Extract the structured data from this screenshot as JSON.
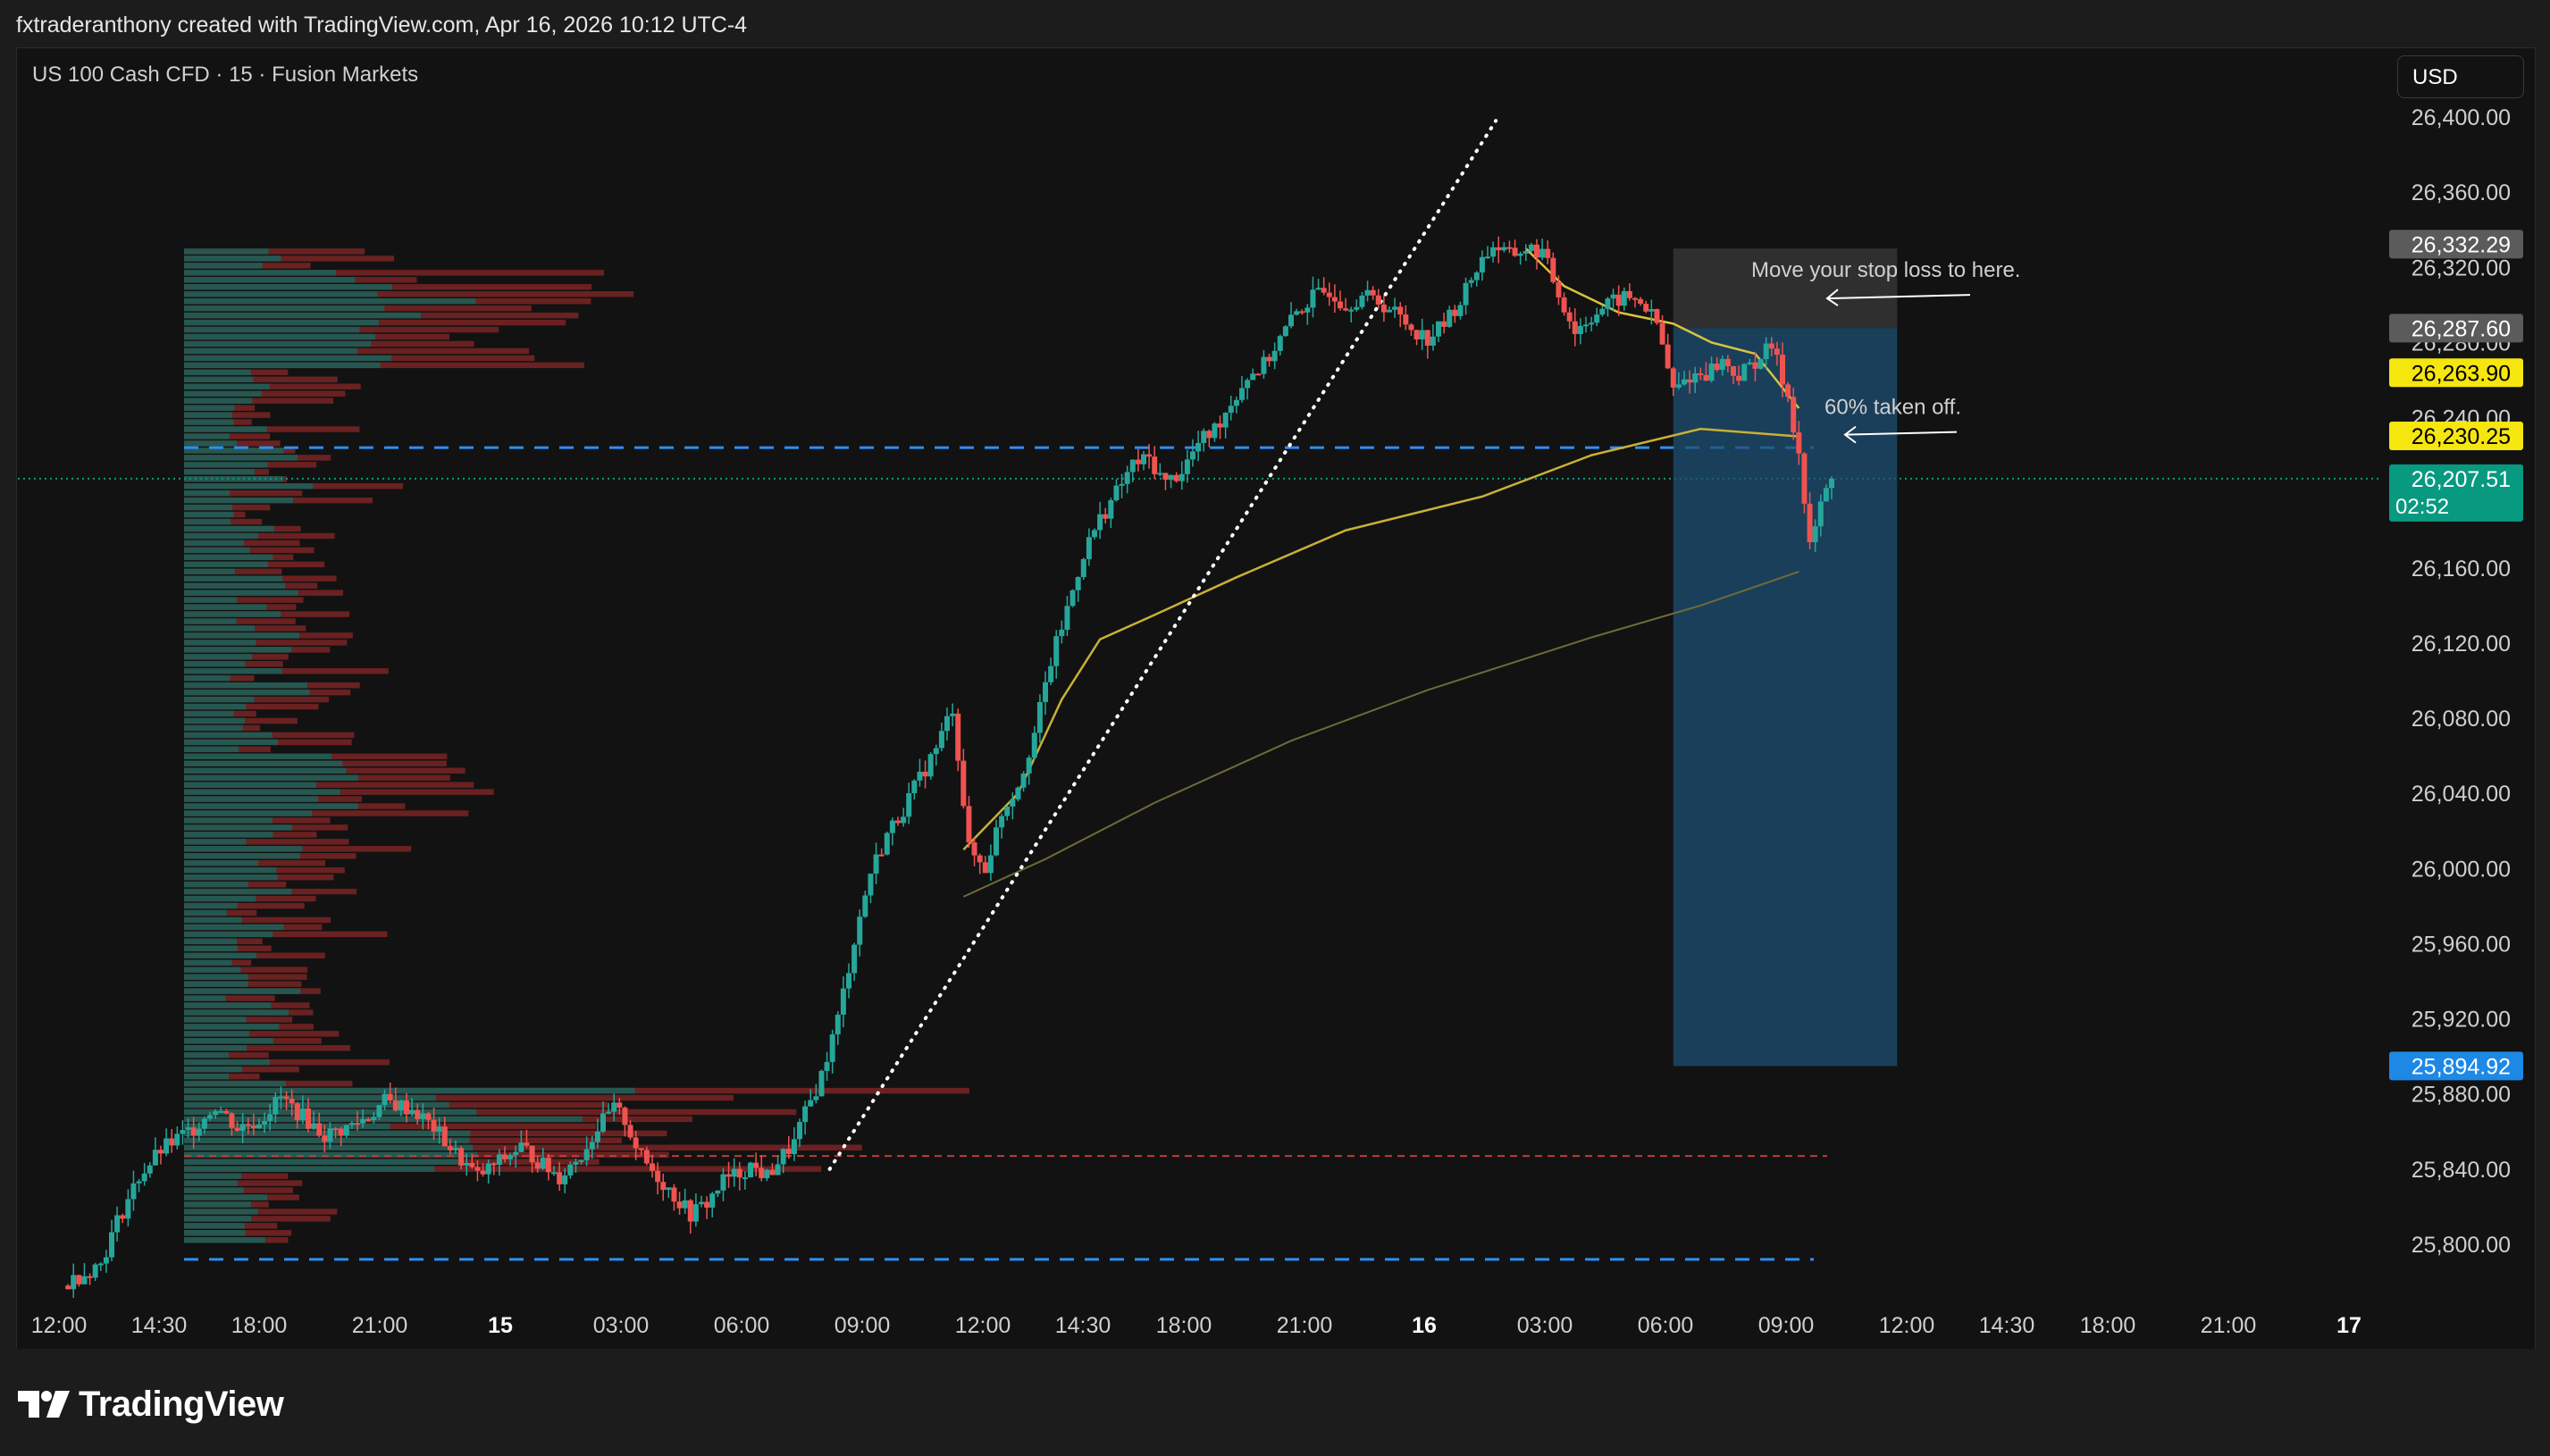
{
  "header": {
    "attribution": "fxtraderanthony created with TradingView.com, Apr 16, 2026 10:12 UTC-4"
  },
  "chart_header": {
    "symbol": "US 100 Cash CFD · 15 · Fusion Markets",
    "currency_button": "USD"
  },
  "branding": {
    "logo_text": "TradingView"
  },
  "colors": {
    "up": "#26a69a",
    "down": "#ef5350",
    "volume_up": "#1f5d55",
    "volume_down": "#7a2424",
    "ema_fast": "#c9b037",
    "ema_slow": "#6e6a3a",
    "position_blue": "#1e4f73",
    "stop_gray": "#555555",
    "dashed_level": "#2d8ff0",
    "last_price": "#089981"
  },
  "chart_data": {
    "type": "candlestick",
    "title": "US 100 Cash CFD · 15 · Fusion Markets",
    "xlabel": "",
    "ylabel": "",
    "ylim": [
      25770,
      26420
    ],
    "x_axis_labels": [
      "12:00",
      "14:30",
      "18:00",
      "21:00",
      "15",
      "03:00",
      "06:00",
      "09:00",
      "12:00",
      "14:30",
      "18:00",
      "21:00",
      "16",
      "03:00",
      "06:00",
      "09:00",
      "12:00",
      "14:30",
      "18:00",
      "21:00",
      "17"
    ],
    "y_axis_ticks": [
      "26,400.00",
      "26,360.00",
      "26,320.00",
      "26,280.00",
      "26,240.00",
      "26,160.00",
      "26,120.00",
      "26,080.00",
      "26,040.00",
      "26,000.00",
      "25,960.00",
      "25,920.00",
      "25,880.00",
      "25,840.00",
      "25,800.00"
    ],
    "price_labels": [
      {
        "text": "26,332.29",
        "value": 26332.29,
        "style": "gray"
      },
      {
        "text": "26,287.60",
        "value": 26287.6,
        "style": "gray"
      },
      {
        "text": "26,263.90",
        "value": 26263.9,
        "style": "yellow"
      },
      {
        "text": "26,230.25",
        "value": 26230.25,
        "style": "yellow"
      },
      {
        "text": "26,207.51",
        "value": 26207.51,
        "style": "last",
        "countdown": "02:52"
      },
      {
        "text": "25,894.92",
        "value": 25894.92,
        "style": "blue"
      }
    ],
    "key_levels": [
      26224,
      25792
    ],
    "annotations": [
      {
        "text": "Move your stop loss to here.",
        "price": 26312
      },
      {
        "text": "60% taken off.",
        "price": 26239
      }
    ],
    "candle_path_points": [
      [
        0,
        25778
      ],
      [
        14,
        25790
      ],
      [
        20,
        25812
      ],
      [
        28,
        25836
      ],
      [
        36,
        25850
      ],
      [
        48,
        25862
      ],
      [
        56,
        25874
      ],
      [
        64,
        25862
      ],
      [
        72,
        25866
      ],
      [
        80,
        25878
      ],
      [
        88,
        25868
      ],
      [
        96,
        25858
      ],
      [
        104,
        25862
      ],
      [
        112,
        25868
      ],
      [
        118,
        25876
      ],
      [
        128,
        25872
      ],
      [
        136,
        25862
      ],
      [
        144,
        25848
      ],
      [
        152,
        25836
      ],
      [
        160,
        25844
      ],
      [
        168,
        25852
      ],
      [
        176,
        25842
      ],
      [
        182,
        25836
      ],
      [
        190,
        25848
      ],
      [
        196,
        25862
      ],
      [
        202,
        25872
      ],
      [
        206,
        25866
      ],
      [
        212,
        25846
      ],
      [
        218,
        25836
      ],
      [
        224,
        25826
      ],
      [
        230,
        25816
      ],
      [
        236,
        25822
      ],
      [
        242,
        25834
      ],
      [
        248,
        25838
      ],
      [
        252,
        25842
      ],
      [
        258,
        25836
      ],
      [
        262,
        25844
      ],
      [
        268,
        25854
      ],
      [
        270,
        25862
      ],
      [
        278,
        25890
      ],
      [
        284,
        25920
      ],
      [
        290,
        25962
      ],
      [
        296,
        25998
      ],
      [
        302,
        26018
      ],
      [
        308,
        26032
      ],
      [
        314,
        26048
      ],
      [
        320,
        26064
      ],
      [
        326,
        26086
      ],
      [
        332,
        26010
      ],
      [
        338,
        26000
      ],
      [
        344,
        26030
      ],
      [
        350,
        26045
      ],
      [
        356,
        26072
      ],
      [
        362,
        26110
      ],
      [
        368,
        26138
      ],
      [
        374,
        26168
      ],
      [
        380,
        26186
      ],
      [
        386,
        26200
      ],
      [
        392,
        26215
      ],
      [
        398,
        26218
      ],
      [
        404,
        26205
      ],
      [
        410,
        26212
      ],
      [
        416,
        26226
      ],
      [
        422,
        26234
      ],
      [
        428,
        26248
      ],
      [
        434,
        26262
      ],
      [
        440,
        26268
      ],
      [
        446,
        26282
      ],
      [
        452,
        26296
      ],
      [
        458,
        26304
      ],
      [
        464,
        26308
      ],
      [
        470,
        26300
      ],
      [
        476,
        26305
      ],
      [
        482,
        26302
      ],
      [
        488,
        26296
      ],
      [
        494,
        26288
      ],
      [
        500,
        26282
      ],
      [
        506,
        26290
      ],
      [
        512,
        26302
      ],
      [
        518,
        26320
      ],
      [
        524,
        26332
      ],
      [
        530,
        26326
      ],
      [
        536,
        26330
      ],
      [
        542,
        26328
      ],
      [
        548,
        26306
      ],
      [
        554,
        26286
      ],
      [
        560,
        26294
      ],
      [
        566,
        26300
      ],
      [
        572,
        26304
      ],
      [
        578,
        26302
      ],
      [
        584,
        26290
      ],
      [
        590,
        26254
      ],
      [
        596,
        26262
      ],
      [
        602,
        26264
      ],
      [
        608,
        26270
      ],
      [
        614,
        26262
      ],
      [
        620,
        26270
      ],
      [
        626,
        26278
      ],
      [
        632,
        26252
      ],
      [
        636,
        26220
      ],
      [
        640,
        26170
      ],
      [
        644,
        26194
      ],
      [
        648,
        26207
      ]
    ],
    "ema_fast_points": [
      [
        330,
        26010
      ],
      [
        350,
        26040
      ],
      [
        366,
        26090
      ],
      [
        380,
        26122
      ],
      [
        400,
        26135
      ],
      [
        430,
        26155
      ],
      [
        470,
        26180
      ],
      [
        520,
        26198
      ],
      [
        560,
        26220
      ],
      [
        600,
        26234
      ],
      [
        636,
        26230
      ]
    ],
    "ema_slow_points": [
      [
        330,
        25985
      ],
      [
        360,
        26005
      ],
      [
        400,
        26035
      ],
      [
        450,
        26068
      ],
      [
        500,
        26095
      ],
      [
        560,
        26123
      ],
      [
        600,
        26140
      ],
      [
        636,
        26158
      ]
    ],
    "ema_short_points": [
      [
        536,
        26330
      ],
      [
        550,
        26310
      ],
      [
        570,
        26296
      ],
      [
        590,
        26290
      ],
      [
        604,
        26280
      ],
      [
        620,
        26274
      ],
      [
        636,
        26245
      ]
    ],
    "trendline": {
      "from": [
        281,
        25840
      ],
      "to": [
        525,
        26398
      ]
    },
    "position": {
      "x_start": 590,
      "x_end": 672,
      "stop_top": 26330,
      "entry": 26287.6,
      "target": 25894.92
    },
    "volume_profile": {
      "note": "Horizontal volume-by-price histogram on the left side",
      "price_from": 25800,
      "price_to": 26330
    }
  }
}
